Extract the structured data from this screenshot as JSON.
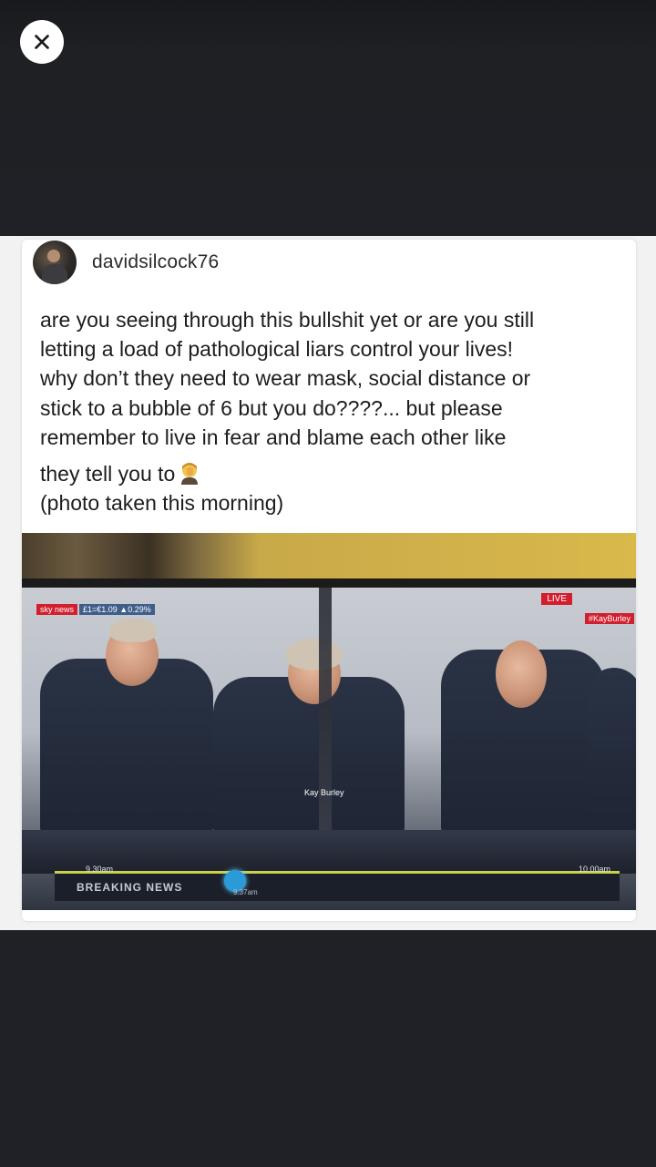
{
  "viewer": {
    "close_icon": "close-icon"
  },
  "post": {
    "username": "davidsilcock76",
    "caption_lines": [
      "are you seeing through this bullshit yet or are you still",
      "letting a load of pathological liars control your lives!",
      "why don’t they need to wear mask, social distance or",
      "stick to a bubble of 6 but you do????... but please",
      "remember to live in fear and blame each other like"
    ],
    "caption_emoji_line": "they tell you to",
    "caption_emoji_icon": "man-facepalming-emoji-icon",
    "caption_last_line": "(photo taken this morning)"
  },
  "tv": {
    "channel": "sky news",
    "ticker": "£1=€1.09 ▲0.29%",
    "live_label": "LIVE",
    "hashtag": "#KayBurley",
    "presenter": "Kay Burley",
    "breaking": "BREAKING NEWS",
    "time_left": "9.30am",
    "time_mid": "9.37am",
    "time_right": "10.00am"
  }
}
